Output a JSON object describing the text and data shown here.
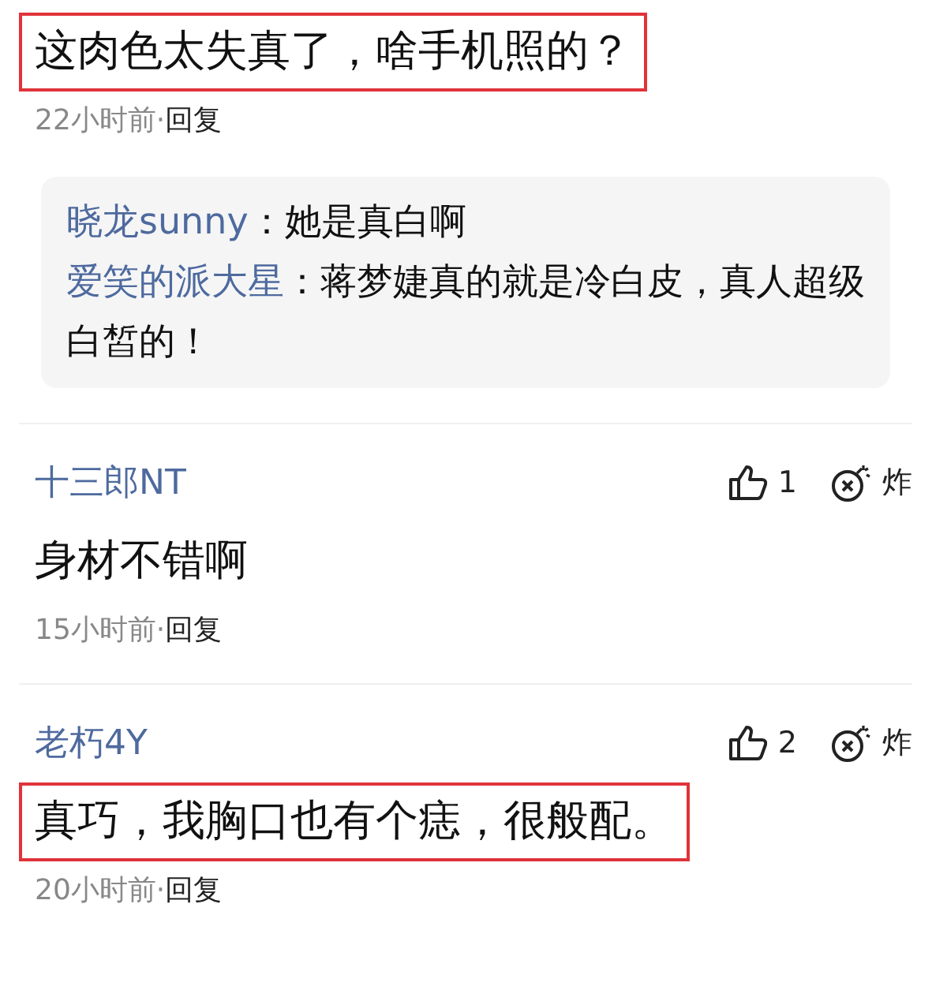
{
  "comments": [
    {
      "text": "这肉色太失真了，啥手机照的？",
      "highlighted": true,
      "time": "22小时前·",
      "reply_label": "回复",
      "replies": [
        {
          "author": "晓龙sunny",
          "text": "：她是真白啊"
        },
        {
          "author": "爱笑的派大星",
          "text": "：蒋梦婕真的就是冷白皮，真人超级白皙的！"
        }
      ]
    },
    {
      "author": "十三郎NT",
      "likes": "1",
      "bury_label": "炸",
      "text": "身材不错啊",
      "highlighted": false,
      "time": "15小时前·",
      "reply_label": "回复"
    },
    {
      "author": "老朽4Y",
      "likes": "2",
      "bury_label": "炸",
      "text": "真巧，我胸口也有个痣，很般配。",
      "highlighted": true,
      "time": "20小时前·",
      "reply_label": "回复"
    }
  ]
}
